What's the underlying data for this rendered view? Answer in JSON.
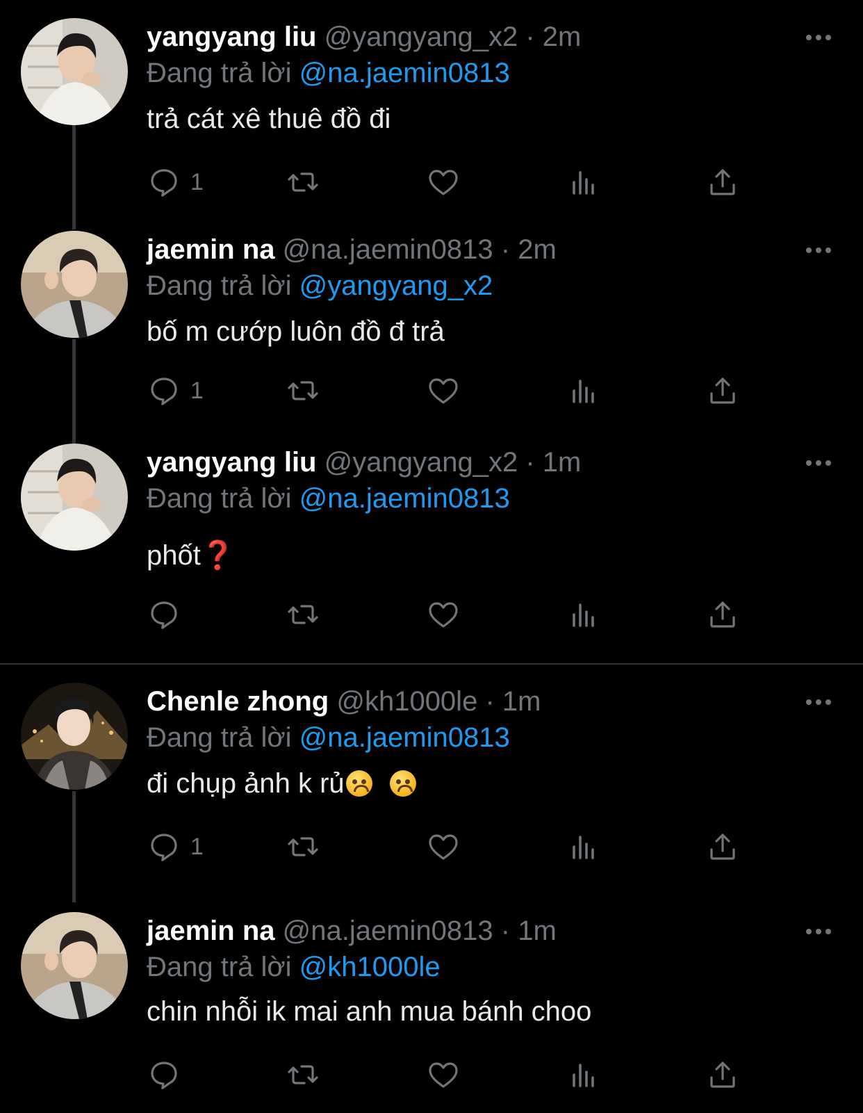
{
  "tweets": [
    {
      "name": "yangyang liu",
      "handle": "@yangyang_x2",
      "time": "· 2m",
      "reply_prefix": "Đang trả lời",
      "reply_to": "@na.jaemin0813",
      "text": "trả cát xê thuê đồ đi",
      "reply_count": "1",
      "avatar": "avatar-yangyang"
    },
    {
      "name": "jaemin na",
      "handle": "@na.jaemin0813",
      "time": "· 2m",
      "reply_prefix": "Đang trả lời",
      "reply_to": "@yangyang_x2",
      "text": "bố m cướp luôn đồ đ trả",
      "reply_count": "1",
      "avatar": "avatar-jaemin"
    },
    {
      "name": "yangyang liu",
      "handle": "@yangyang_x2",
      "time": "· 1m",
      "reply_prefix": "Đang trả lời",
      "reply_to": "@na.jaemin0813",
      "text": "phốt",
      "text_emoji": "❓",
      "reply_count": "",
      "avatar": "avatar-yangyang"
    },
    {
      "name": "Chenle zhong",
      "handle": "@kh1000le",
      "time": "· 1m",
      "reply_prefix": "Đang trả lời",
      "reply_to": "@na.jaemin0813",
      "text": "đi chụp ảnh k rủ",
      "reply_count": "1",
      "avatar": "avatar-chenle"
    },
    {
      "name": "jaemin na",
      "handle": "@na.jaemin0813",
      "time": "· 1m",
      "reply_prefix": "Đang trả lời",
      "reply_to": "@kh1000le",
      "text": "chin nhỗi ik mai anh mua bánh choo",
      "reply_count": "",
      "avatar": "avatar-jaemin"
    }
  ],
  "icons": {
    "reply": "reply-icon",
    "retweet": "retweet-icon",
    "like": "heart-icon",
    "views": "views-icon",
    "share": "share-icon",
    "more": "more-icon"
  },
  "colors": {
    "background": "#000000",
    "text": "#e7e9ea",
    "muted": "#71767b",
    "mention": "#1d9bf0",
    "divider": "#2f3336"
  }
}
